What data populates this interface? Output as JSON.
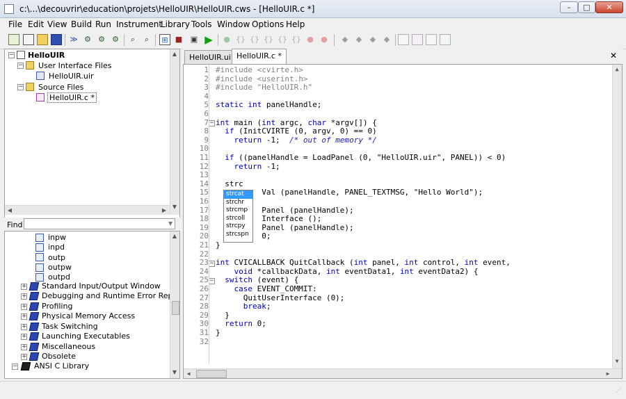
{
  "window": {
    "title": "c:\\...\\decouvrir\\education\\projets\\HelloUIR\\HelloUIR.cws - [HelloUIR.c *]",
    "minimize": "–",
    "maximize": "□",
    "close": "✕"
  },
  "menu": [
    "File",
    "Edit",
    "View",
    "Build",
    "Run",
    "Instrument",
    "Library",
    "Tools",
    "Window",
    "Options",
    "Help"
  ],
  "project_tree": {
    "root": "HelloUIR",
    "folder_ui": "User Interface Files",
    "file_uir": "HelloUIR.uir",
    "folder_src": "Source Files",
    "file_c": "HelloUIR.c *"
  },
  "find": {
    "label": "Find",
    "value": ""
  },
  "library_tree": {
    "functions": [
      "inpw",
      "inpd",
      "outp",
      "outpw",
      "outpd"
    ],
    "libraries": [
      "Standard Input/Output Window",
      "Debugging and Runtime Error Reporting",
      "Profiling",
      "Physical Memory Access",
      "Task Switching",
      "Launching Executables",
      "Miscellaneous",
      "Obsolete"
    ],
    "ansi": "ANSI C Library"
  },
  "tabs": [
    "HelloUIR.uir",
    "HelloUIR.c *"
  ],
  "tabs_close": "✕",
  "editor": {
    "line_numbers": [
      "1",
      "2",
      "3",
      "4",
      "5",
      "6",
      "7",
      "8",
      "9",
      "10",
      "11",
      "12",
      "13",
      "14",
      "15",
      "16",
      "17",
      "18",
      "19",
      "20",
      "21",
      "22",
      "23",
      "24",
      "25",
      "26",
      "27",
      "28",
      "29",
      "30",
      "31",
      "32"
    ],
    "lines": [
      "#include <cvirte.h>",
      "#include <userint.h>",
      "#include \"HelloUIR.h\"",
      "",
      "static int panelHandle;",
      "",
      "int main (int argc, char *argv[]) {",
      "  if (InitCVIRTE (0, argv, 0) == 0)",
      "    return -1;  /* out of memory */",
      "",
      "  if ((panelHandle = LoadPanel (0, \"HelloUIR.uir\", PANEL)) < 0)",
      "    return -1;",
      "",
      "  strc",
      "          Val (panelHandle, PANEL_TEXTMSG, \"Hello World\");",
      "",
      "          Panel (panelHandle);",
      "          Interface ();",
      "          Panel (panelHandle);",
      "          0;",
      "}",
      "",
      "int CVICALLBACK QuitCallback (int panel, int control, int event,",
      "    void *callbackData, int eventData1, int eventData2) {",
      "  switch (event) {",
      "    case EVENT_COMMIT:",
      "      QuitUserInterface (0);",
      "      break;",
      "  }",
      "  return 0;",
      "}",
      ""
    ],
    "autocomplete": [
      "strcat",
      "strchr",
      "strcmp",
      "strcoll",
      "strcpy",
      "strcspn"
    ]
  },
  "colors": {
    "keyword": "#0000c0",
    "preprocessor": "#808080",
    "selection": "#3399ff",
    "brand_icon": "#2a46b0"
  }
}
